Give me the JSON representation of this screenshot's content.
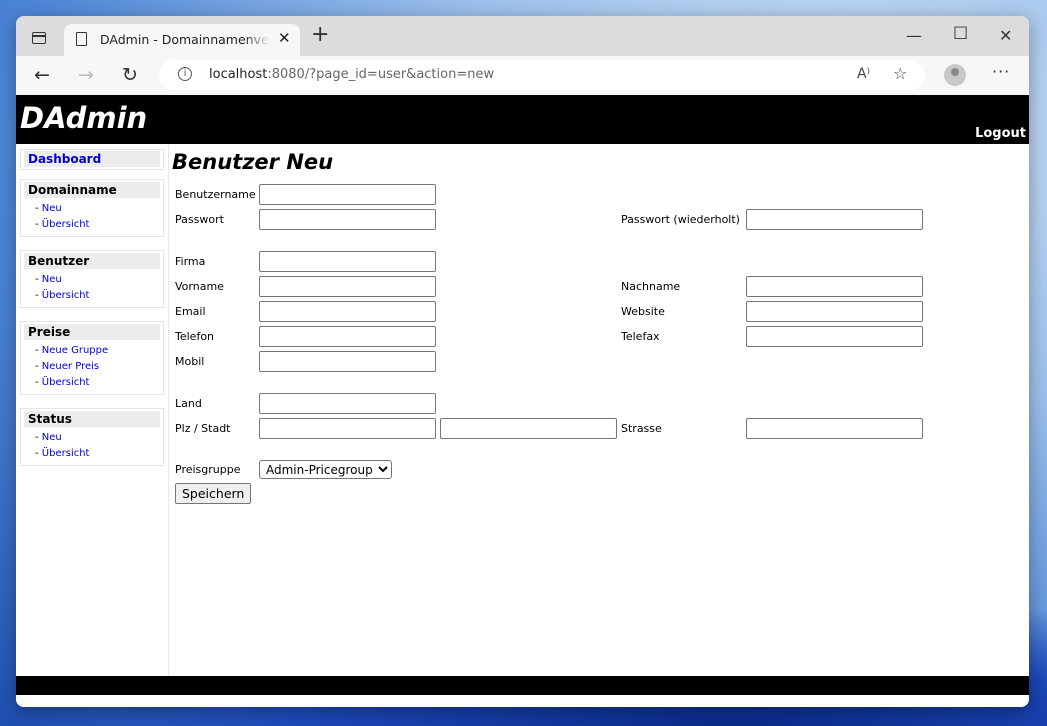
{
  "browser": {
    "tab_title": "DAdmin - Domainnamenverwaltung",
    "url_host": "localhost",
    "url_rest": ":8080/?page_id=user&action=new"
  },
  "app": {
    "logo": "DAdmin",
    "logout": "Logout"
  },
  "sidebar": {
    "dashboard": "Dashboard",
    "sections": [
      {
        "title": "Domainname",
        "items": [
          "Neu",
          "Übersicht"
        ]
      },
      {
        "title": "Benutzer",
        "items": [
          "Neu",
          "Übersicht"
        ]
      },
      {
        "title": "Preise",
        "items": [
          "Neue Gruppe",
          "Neuer Preis",
          "Übersicht"
        ]
      },
      {
        "title": "Status",
        "items": [
          "Neu",
          "Übersicht"
        ]
      }
    ]
  },
  "form": {
    "title": "Benutzer Neu",
    "labels": {
      "username": "Benutzername",
      "password": "Passwort",
      "password_repeat": "Passwort (wiederholt)",
      "company": "Firma",
      "firstname": "Vorname",
      "lastname": "Nachname",
      "email": "Email",
      "website": "Website",
      "phone": "Telefon",
      "fax": "Telefax",
      "mobile": "Mobil",
      "country": "Land",
      "zip_city": "Plz / Stadt",
      "street": "Strasse",
      "pricegroup": "Preisgruppe"
    },
    "pricegroup_selected": "Admin-Pricegroup",
    "save_label": "Speichern"
  }
}
